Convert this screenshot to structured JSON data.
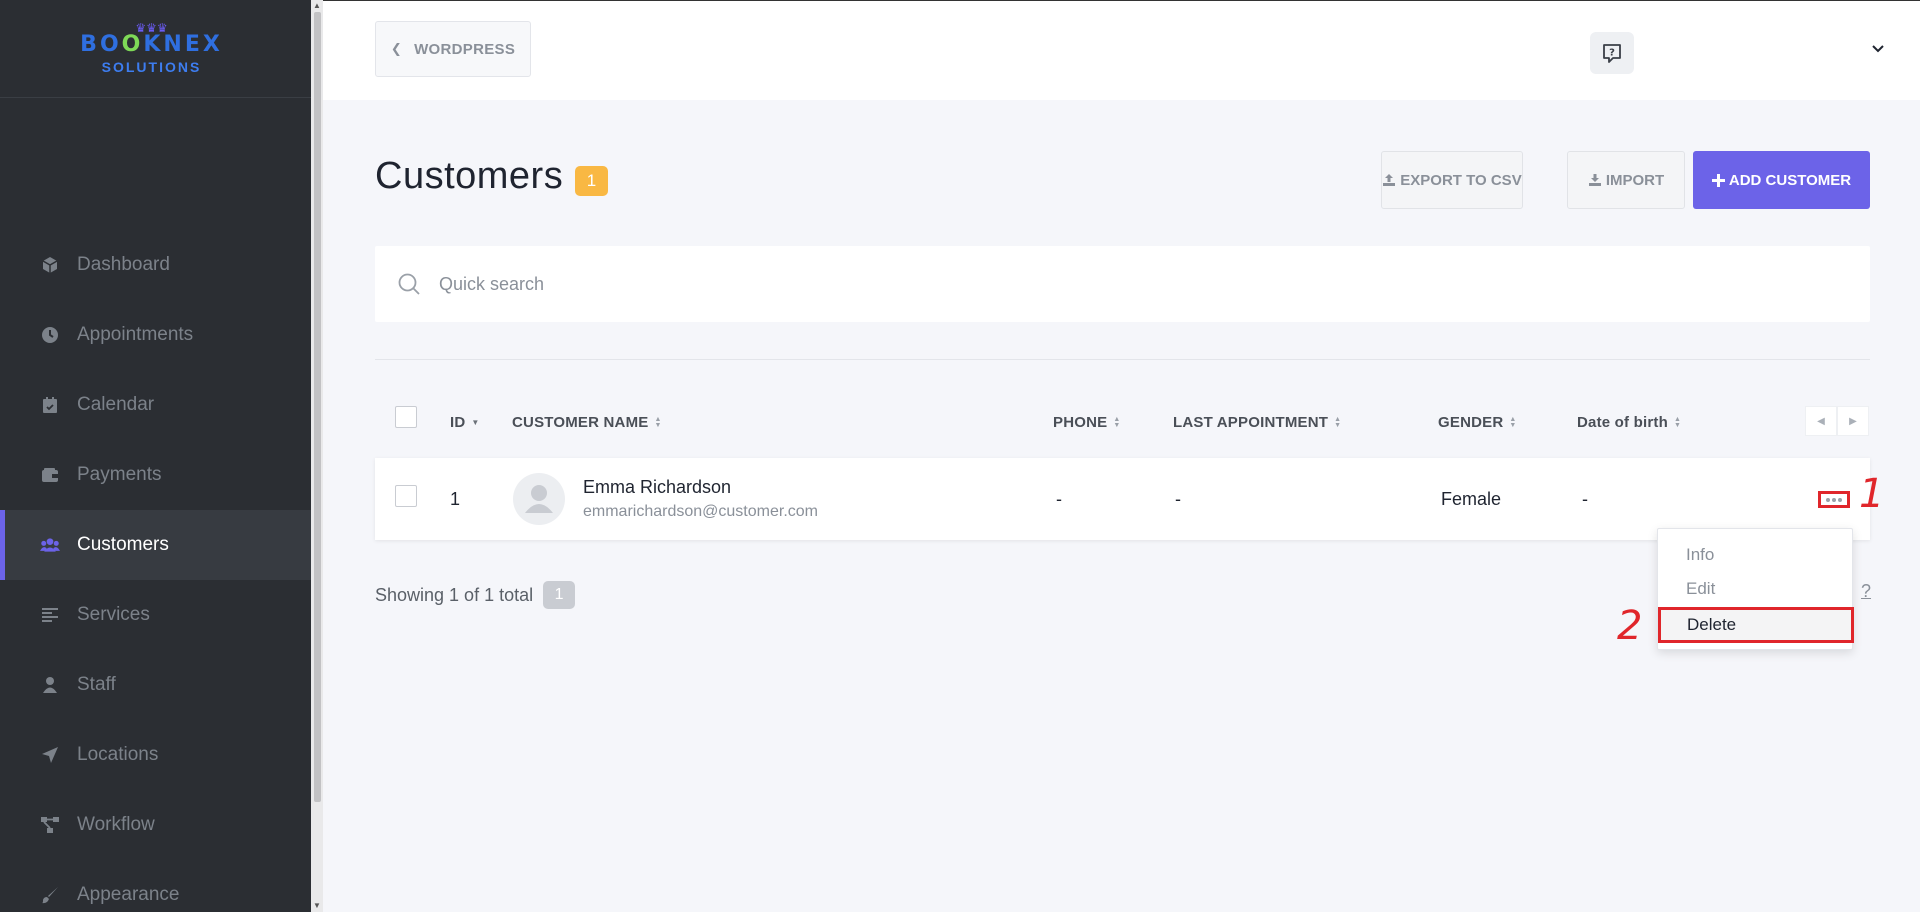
{
  "brand": {
    "logo_part1": "BO",
    "logo_part2": "O",
    "logo_part3": "KNEX",
    "logo_sub": "SOLUTIONS",
    "colors": {
      "primary": "#2f6fe0",
      "check": "#7ed957",
      "crown": "#6b5cf5"
    }
  },
  "sidebar": {
    "items": [
      {
        "label": "Dashboard",
        "icon": "cube-icon",
        "active": false
      },
      {
        "label": "Appointments",
        "icon": "clock-icon",
        "active": false
      },
      {
        "label": "Calendar",
        "icon": "calendar-check-icon",
        "active": false
      },
      {
        "label": "Payments",
        "icon": "wallet-icon",
        "active": false
      },
      {
        "label": "Customers",
        "icon": "users-icon",
        "active": true
      },
      {
        "label": "Services",
        "icon": "list-icon",
        "active": false
      },
      {
        "label": "Staff",
        "icon": "user-icon",
        "active": false
      },
      {
        "label": "Locations",
        "icon": "location-arrow-icon",
        "active": false
      },
      {
        "label": "Workflow",
        "icon": "workflow-icon",
        "active": false
      },
      {
        "label": "Appearance",
        "icon": "brush-icon",
        "active": false
      }
    ]
  },
  "topbar": {
    "wordpress_label": "WORDPRESS"
  },
  "page": {
    "title": "Customers",
    "count_badge": "1",
    "export_label": "EXPORT TO CSV",
    "import_label": "IMPORT",
    "add_label": "ADD CUSTOMER"
  },
  "search": {
    "placeholder": "Quick search"
  },
  "table": {
    "columns": {
      "id": "ID",
      "name": "CUSTOMER NAME",
      "phone": "PHONE",
      "last_appointment": "LAST APPOINTMENT",
      "gender": "GENDER",
      "dob": "Date of birth"
    },
    "rows": [
      {
        "id": "1",
        "name": "Emma Richardson",
        "email": "emmarichardson@customer.com",
        "phone": "-",
        "last_appointment": "-",
        "gender": "Female",
        "dob": "-"
      }
    ]
  },
  "row_menu": {
    "info": "Info",
    "edit": "Edit",
    "delete": "Delete"
  },
  "annotations": {
    "step1": "1",
    "step2": "2",
    "color": "#e0262b"
  },
  "footer": {
    "showing_text": "Showing 1 of 1 total",
    "showing_badge": "1",
    "per_page_hint": "?"
  },
  "colors": {
    "sidebar_bg": "#2b2e33",
    "accent": "#6c63e8",
    "badge": "#f9b843"
  }
}
